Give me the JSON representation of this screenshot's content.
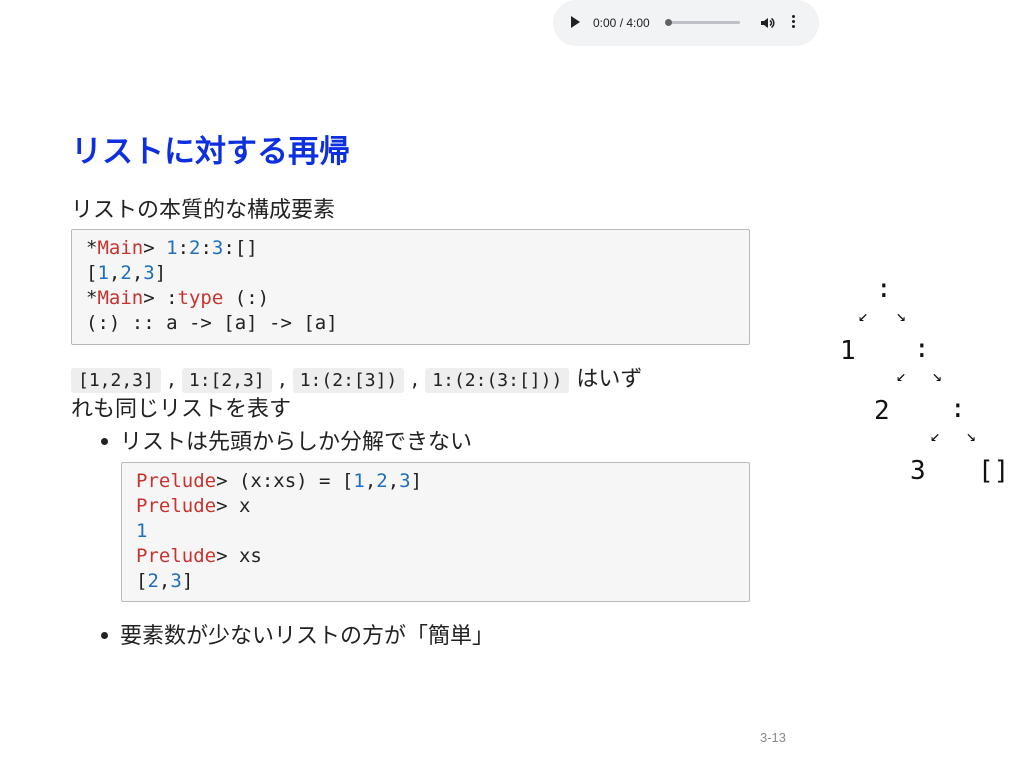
{
  "audio": {
    "time": "0:00 / 4:00",
    "progress": 0
  },
  "title": "リストに対する再帰",
  "intro": "リストの本質的な構成要素",
  "code1": {
    "l1_prompt_star": "*",
    "l1_prompt": "Main",
    "l1_gt": "> ",
    "l1_a": "1",
    "l1_b": ":",
    "l1_c": "2",
    "l1_d": ":",
    "l1_e": "3",
    "l1_f": ":[]",
    "l2_open": "[",
    "l2_a": "1",
    "l2_c1": ",",
    "l2_b": "2",
    "l2_c2": ",",
    "l2_c": "3",
    "l2_close": "]",
    "l3_prompt_star": "*",
    "l3_prompt": "Main",
    "l3_gt": "> :",
    "l3_kw": "type",
    "l3_rest": " (:)",
    "l4": "(:) :: a -> [a] -> [a]"
  },
  "same": {
    "c1": "[1,2,3]",
    "sep1": ",",
    "c2": "1:[2,3]",
    "sep2": ",",
    "c3": "1:(2:[3])",
    "sep3": ",",
    "c4": "1:(2:(3:[]))",
    "tail1": "はいず",
    "line2": "れも同じリストを表す"
  },
  "bullets": [
    "リストは先頭からしか分解できない",
    "要素数が少ないリストの方が「簡単」"
  ],
  "code2": {
    "p1": "Prelude",
    "g1": "> (x:xs) = [",
    "n1": "1",
    "c1": ",",
    "n2": "2",
    "c2": ",",
    "n3": "3",
    "e1": "]",
    "p2": "Prelude",
    "g2": "> x",
    "v1": "1",
    "p3": "Prelude",
    "g3": "> xs",
    "o": "[",
    "v2": "2",
    "c3": ",",
    "v3": "3",
    "cl": "]"
  },
  "tree": {
    "root": ":",
    "n1": "1",
    "c2": ":",
    "n2": "2",
    "c3": ":",
    "n3": "3",
    "nil": "[]",
    "arrow_left": "↙",
    "arrow_right": "↘"
  },
  "page": "3-13"
}
